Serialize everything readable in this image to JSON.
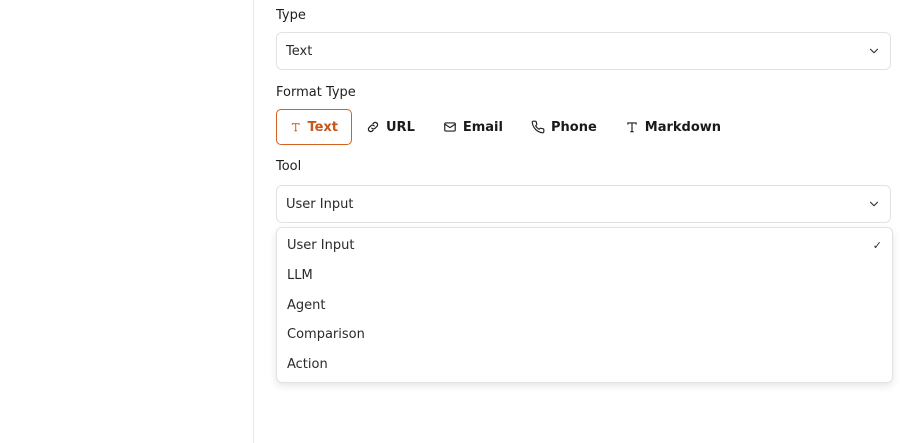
{
  "type_field": {
    "label": "Type",
    "value": "Text"
  },
  "format_type": {
    "label": "Format Type",
    "options": [
      {
        "label": "Text",
        "icon": "text-icon",
        "selected": true
      },
      {
        "label": "URL",
        "icon": "link-icon",
        "selected": false
      },
      {
        "label": "Email",
        "icon": "mail-icon",
        "selected": false
      },
      {
        "label": "Phone",
        "icon": "phone-icon",
        "selected": false
      },
      {
        "label": "Markdown",
        "icon": "text-icon",
        "selected": false
      }
    ]
  },
  "tool_field": {
    "label": "Tool",
    "value": "User Input",
    "options": [
      {
        "label": "User Input",
        "checked": true
      },
      {
        "label": "LLM",
        "checked": false
      },
      {
        "label": "Agent",
        "checked": false
      },
      {
        "label": "Comparison",
        "checked": false
      },
      {
        "label": "Action",
        "checked": false
      }
    ],
    "check_mark": "✓"
  },
  "colors": {
    "accent": "#d4621f",
    "accent_text": "#c8561a",
    "border": "#e2e2e2",
    "text": "#1f1f1f"
  }
}
